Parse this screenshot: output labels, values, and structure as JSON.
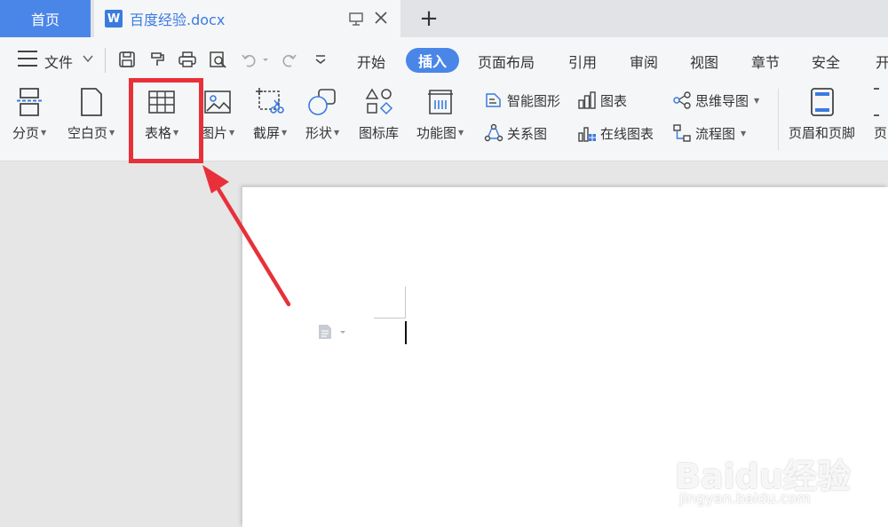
{
  "tabs": {
    "home": "首页",
    "doc_icon_letter": "W",
    "doc_title": "百度经验.docx",
    "add": "+"
  },
  "menubar": {
    "file": "文件",
    "items": [
      "开始",
      "插入",
      "页面布局",
      "引用",
      "审阅",
      "视图",
      "章节",
      "安全",
      "开"
    ]
  },
  "ribbon": {
    "large": {
      "page_break": "分页",
      "blank_page": "空白页",
      "table": "表格",
      "picture": "图片",
      "screenshot": "截屏",
      "shape": "形状",
      "icon_lib": "图标库",
      "func_chart": "功能图",
      "header_footer": "页眉和页脚",
      "page_partial": "页"
    },
    "small": {
      "smart_shape": "智能图形",
      "chart": "图表",
      "mind_map": "思维导图",
      "relation": "关系图",
      "online_chart": "在线图表",
      "flowchart": "流程图"
    }
  },
  "watermark": {
    "logo": "Baidu经验",
    "url": "jingyan.baidu.com"
  },
  "colors": {
    "accent": "#4a86e8",
    "highlight": "#e8303a",
    "icon_blue": "#3b7be0"
  }
}
